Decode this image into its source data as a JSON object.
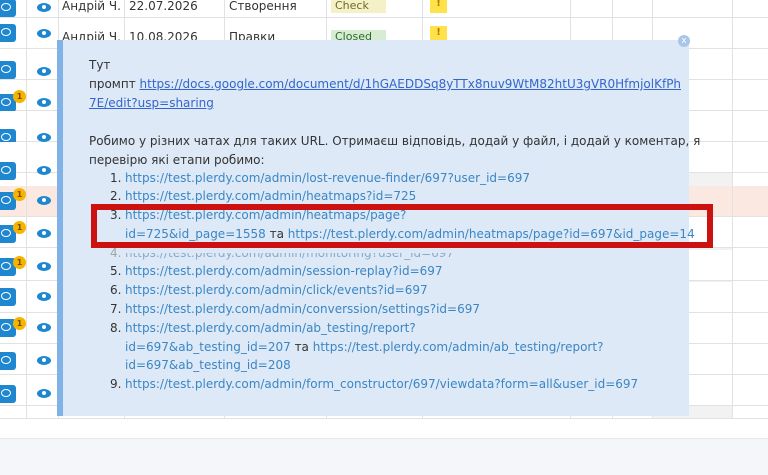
{
  "table": {
    "rows": [
      {
        "user": "Андрій Ч.",
        "date": "22.07.2026",
        "stage": "Створення",
        "status": "Check",
        "warn": "!"
      },
      {
        "user": "Андрій Ч.",
        "date": "10.08.2026",
        "stage": "Правки",
        "status": "Closed",
        "warn": "!"
      }
    ],
    "badges": [
      "1",
      "1",
      "1",
      "1"
    ]
  },
  "popup": {
    "close_label": "x",
    "line1": "Тут",
    "prompt_label": "промпт ",
    "prompt_url_1": "https://docs.google.com/document/d/1hGAEDDSq8yTTx8nuv9WtM82htU3gVR0HfmjolKfPh",
    "prompt_url_2": "7E/edit?usp=sharing",
    "intro_1": "Робимо у різних чатах для таких URL. Отримаєш відповідь, додай у файл, і додай у коментар, я",
    "intro_2": "перевірю які етапи робимо:",
    "items": [
      {
        "num": "1.",
        "text": "https://test.plerdy.com/admin/lost-revenue-finder/697?user_id=697"
      },
      {
        "num": "2.",
        "text": "https://test.plerdy.com/admin/heatmaps?id=725"
      },
      {
        "num": "3.",
        "text": "https://test.plerdy.com/admin/heatmaps/page?"
      },
      {
        "num": "",
        "text": "id=725&id_page=1558",
        "joiner": " та ",
        "text2": "https://test.plerdy.com/admin/heatmaps/page?id=697&id_page=14"
      },
      {
        "num": "4.",
        "text": "https://test.plerdy.com/admin/monitoring?user_id=697"
      },
      {
        "num": "5.",
        "text": "https://test.plerdy.com/admin/session-replay?id=697"
      },
      {
        "num": "6.",
        "text": "https://test.plerdy.com/admin/click/events?id=697"
      },
      {
        "num": "7.",
        "text": "https://test.plerdy.com/admin/converssion/settings?id=697"
      },
      {
        "num": "8.",
        "text": "https://test.plerdy.com/admin/ab_testing/report?"
      },
      {
        "num": "",
        "text": "id=697&ab_testing_id=207",
        "joiner": " та ",
        "text2": "https://test.plerdy.com/admin/ab_testing/report?"
      },
      {
        "num": "",
        "text": "id=697&ab_testing_id=208"
      },
      {
        "num": "9.",
        "text": "https://test.plerdy.com/admin/form_constructor/697/viewdata?form=all&user_id=697"
      }
    ]
  }
}
